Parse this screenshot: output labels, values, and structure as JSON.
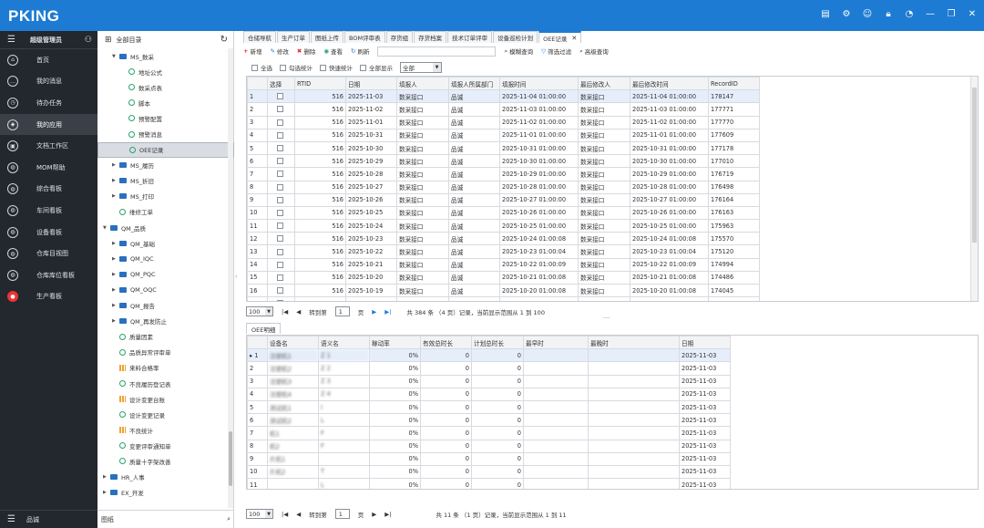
{
  "app": {
    "logo": "PKING"
  },
  "titlebar": {
    "icons": [
      "doc-icon",
      "user-settings-icon",
      "user-icon",
      "lock-icon",
      "smiley-icon",
      "minimize-icon",
      "restore-icon",
      "close-icon"
    ]
  },
  "nav": {
    "user": "超级管理员",
    "items": [
      "首页",
      "我的消息",
      "待办任务",
      "我的应用",
      "文档工作区",
      "MOM帮助",
      "综合看板",
      "车间看板",
      "设备看板",
      "仓库目视图",
      "仓库库位看板",
      "生产看板"
    ],
    "active": 3,
    "bottom": "品诚"
  },
  "tree": {
    "root": "全部目录",
    "search_value": "图纸",
    "nodes": [
      {
        "label": "MS_数采",
        "kind": "folder",
        "open": true,
        "level": 1
      },
      {
        "label": "地址公式",
        "kind": "leaf",
        "level": 2
      },
      {
        "label": "数采点表",
        "kind": "leaf",
        "level": 2
      },
      {
        "label": "脚本",
        "kind": "leaf",
        "level": 2
      },
      {
        "label": "预警配置",
        "kind": "leaf",
        "level": 2
      },
      {
        "label": "预警消息",
        "kind": "leaf",
        "level": 2
      },
      {
        "label": "OEE记录",
        "kind": "leaf",
        "level": 2,
        "selected": true
      },
      {
        "label": "MS_履历",
        "kind": "folder",
        "level": 1
      },
      {
        "label": "MS_折旧",
        "kind": "folder",
        "level": 1
      },
      {
        "label": "MS_打印",
        "kind": "folder",
        "level": 1
      },
      {
        "label": "维修工单",
        "kind": "leaf",
        "level": 1
      },
      {
        "label": "QM_品质",
        "kind": "folder",
        "open": true,
        "level": 0
      },
      {
        "label": "QM_基础",
        "kind": "folder",
        "level": 1
      },
      {
        "label": "QM_IQC",
        "kind": "folder",
        "level": 1
      },
      {
        "label": "QM_PQC",
        "kind": "folder",
        "level": 1
      },
      {
        "label": "QM_OQC",
        "kind": "folder",
        "level": 1
      },
      {
        "label": "QM_报告",
        "kind": "folder",
        "level": 1
      },
      {
        "label": "QM_再发防止",
        "kind": "folder",
        "level": 1
      },
      {
        "label": "质量因素",
        "kind": "leaf",
        "level": 1
      },
      {
        "label": "品质异常评审单",
        "kind": "leaf",
        "level": 1
      },
      {
        "label": "来料合格率",
        "kind": "bar",
        "level": 1
      },
      {
        "label": "不良履历登记表",
        "kind": "leaf",
        "level": 1
      },
      {
        "label": "设计变更台账",
        "kind": "bar",
        "level": 1
      },
      {
        "label": "设计变更记录",
        "kind": "leaf",
        "level": 1
      },
      {
        "label": "不良统计",
        "kind": "bar",
        "level": 1
      },
      {
        "label": "变更评审通知单",
        "kind": "leaf",
        "level": 1
      },
      {
        "label": "质量十字架改善",
        "kind": "leaf",
        "level": 1
      },
      {
        "label": "HR_人事",
        "kind": "folder",
        "level": 0
      },
      {
        "label": "EX_开发",
        "kind": "folder",
        "level": 0
      }
    ]
  },
  "tabs": [
    "仓储导航",
    "生产订单",
    "图纸上传",
    "BOM评审表",
    "存货组",
    "存货档案",
    "技术订单评审",
    "设备巡检计划",
    "OEE记录"
  ],
  "active_tab": 8,
  "toolbar": {
    "new": "新增",
    "edit": "修改",
    "delete": "删除",
    "view": "查看",
    "refresh": "刷新",
    "fuzzy": "模糊查询",
    "filter": "筛选过滤",
    "advanced": "高级查询"
  },
  "options": {
    "select_all": "全选",
    "check_stats": "勾选统计",
    "quick_stats": "快速统计",
    "show_all": "全部显示",
    "dropdown": "全部"
  },
  "grid1": {
    "headers": [
      "",
      "选择",
      "RTID",
      "日期",
      "填报人",
      "填报人所属部门",
      "填报时间",
      "最后修改人",
      "最后修改时间",
      "RecordID"
    ],
    "rows": [
      [
        "1",
        "516",
        "2025-11-03",
        "数采接口",
        "品诚",
        "2025-11-04 01:00:00",
        "数采接口",
        "2025-11-04 01:00:00",
        "178147"
      ],
      [
        "2",
        "516",
        "2025-11-02",
        "数采接口",
        "品诚",
        "2025-11-03 01:00:00",
        "数采接口",
        "2025-11-03 01:00:00",
        "177771"
      ],
      [
        "3",
        "516",
        "2025-11-01",
        "数采接口",
        "品诚",
        "2025-11-02 01:00:00",
        "数采接口",
        "2025-11-02 01:00:00",
        "177770"
      ],
      [
        "4",
        "516",
        "2025-10-31",
        "数采接口",
        "品诚",
        "2025-11-01 01:00:00",
        "数采接口",
        "2025-11-01 01:00:00",
        "177609"
      ],
      [
        "5",
        "516",
        "2025-10-30",
        "数采接口",
        "品诚",
        "2025-10-31 01:00:00",
        "数采接口",
        "2025-10-31 01:00:00",
        "177178"
      ],
      [
        "6",
        "516",
        "2025-10-29",
        "数采接口",
        "品诚",
        "2025-10-30 01:00:00",
        "数采接口",
        "2025-10-30 01:00:00",
        "177010"
      ],
      [
        "7",
        "516",
        "2025-10-28",
        "数采接口",
        "品诚",
        "2025-10-29 01:00:00",
        "数采接口",
        "2025-10-29 01:00:00",
        "176719"
      ],
      [
        "8",
        "516",
        "2025-10-27",
        "数采接口",
        "品诚",
        "2025-10-28 01:00:00",
        "数采接口",
        "2025-10-28 01:00:00",
        "176498"
      ],
      [
        "9",
        "516",
        "2025-10-26",
        "数采接口",
        "品诚",
        "2025-10-27 01:00:00",
        "数采接口",
        "2025-10-27 01:00:00",
        "176164"
      ],
      [
        "10",
        "516",
        "2025-10-25",
        "数采接口",
        "品诚",
        "2025-10-26 01:00:00",
        "数采接口",
        "2025-10-26 01:00:00",
        "176163"
      ],
      [
        "11",
        "516",
        "2025-10-24",
        "数采接口",
        "品诚",
        "2025-10-25 01:00:00",
        "数采接口",
        "2025-10-25 01:00:00",
        "175963"
      ],
      [
        "12",
        "516",
        "2025-10-23",
        "数采接口",
        "品诚",
        "2025-10-24 01:00:08",
        "数采接口",
        "2025-10-24 01:00:08",
        "175570"
      ],
      [
        "13",
        "516",
        "2025-10-22",
        "数采接口",
        "品诚",
        "2025-10-23 01:00:04",
        "数采接口",
        "2025-10-23 01:00:04",
        "175120"
      ],
      [
        "14",
        "516",
        "2025-10-21",
        "数采接口",
        "品诚",
        "2025-10-22 01:00:09",
        "数采接口",
        "2025-10-22 01:00:09",
        "174994"
      ],
      [
        "15",
        "516",
        "2025-10-20",
        "数采接口",
        "品诚",
        "2025-10-21 01:00:08",
        "数采接口",
        "2025-10-21 01:00:08",
        "174486"
      ],
      [
        "16",
        "516",
        "2025-10-19",
        "数采接口",
        "品诚",
        "2025-10-20 01:00:08",
        "数采接口",
        "2025-10-20 01:00:08",
        "174045"
      ],
      [
        "17",
        "516",
        "2025-10-18",
        "数采接口",
        "品诚",
        "2025-10-19 01:00:08",
        "数采接口",
        "2025-10-19 01:00:08",
        "174044"
      ]
    ]
  },
  "pager1": {
    "size": "100",
    "goto": "转到第",
    "page": "1",
    "unit": "页",
    "info": "共 384 条 （4 页）记录，当前显示范围从 1 到 100"
  },
  "subtab": "OEE明细",
  "grid2": {
    "headers": [
      "",
      "设备名",
      "语义名",
      "稼动率",
      "有效总时长",
      "计划总时长",
      "最早时",
      "最晚时",
      "日期"
    ],
    "rows": [
      [
        "1",
        "注塑机1",
        "Z  1",
        "0%",
        "0",
        "0",
        "",
        "",
        "2025-11-03"
      ],
      [
        "2",
        "注塑机2",
        "Z  2",
        "0%",
        "0",
        "0",
        "",
        "",
        "2025-11-03"
      ],
      [
        "3",
        "注塑机3",
        "Z  3",
        "0%",
        "0",
        "0",
        "",
        "",
        "2025-11-03"
      ],
      [
        "4",
        "注塑机4",
        "Z  4",
        "0%",
        "0",
        "0",
        "",
        "",
        "2025-11-03"
      ],
      [
        "5",
        "测试机1",
        "I",
        "0%",
        "0",
        "0",
        "",
        "",
        "2025-11-03"
      ],
      [
        "6",
        "测试机2",
        "L",
        "0%",
        "0",
        "0",
        "",
        "",
        "2025-11-03"
      ],
      [
        "7",
        "机1",
        "F",
        "0%",
        "0",
        "0",
        "",
        "",
        "2025-11-03"
      ],
      [
        "8",
        "机2",
        "F",
        "0%",
        "0",
        "0",
        "",
        "",
        "2025-11-03"
      ],
      [
        "9",
        "片机1",
        "",
        "0%",
        "0",
        "0",
        "",
        "",
        "2025-11-03"
      ],
      [
        "10",
        "片机2",
        "T",
        "0%",
        "0",
        "0",
        "",
        "",
        "2025-11-03"
      ],
      [
        "11",
        "",
        "L",
        "0%",
        "0",
        "0",
        "",
        "",
        "2025-11-03"
      ]
    ]
  },
  "pager2": {
    "size": "100",
    "goto": "转到第",
    "page": "1",
    "unit": "页",
    "info": "共 11 条 （1 页）记录，当前显示范围从 1 到 11"
  }
}
